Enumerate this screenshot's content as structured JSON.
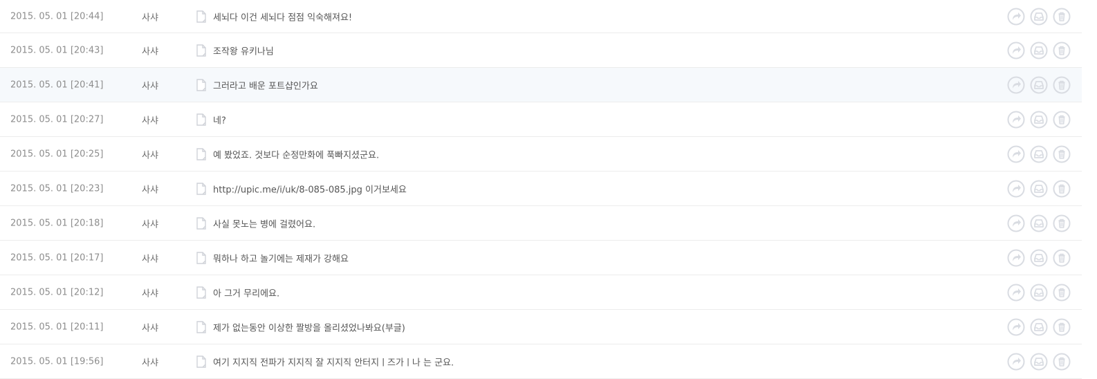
{
  "colors": {
    "icon": "#d9dce2",
    "row_border": "#ececec",
    "highlight_bg": "#f6f9fc"
  },
  "icons": {
    "document": "document-icon",
    "reply": "reply-icon",
    "save": "inbox-icon",
    "delete": "trash-icon"
  },
  "messages": [
    {
      "date": "2015. 05. 01 [20:44]",
      "user": "사샤",
      "text": "세뇌다 이건 세뇌다 점점 익숙해져요!"
    },
    {
      "date": "2015. 05. 01 [20:43]",
      "user": "사샤",
      "text": "조작왕 유키나님"
    },
    {
      "date": "2015. 05. 01 [20:41]",
      "user": "사샤",
      "text": "그러라고 배운 포트샵인가요"
    },
    {
      "date": "2015. 05. 01 [20:27]",
      "user": "사샤",
      "text": "네?"
    },
    {
      "date": "2015. 05. 01 [20:25]",
      "user": "사샤",
      "text": "예 봤었죠. 것보다 순정만화에 푹빠지셨군요."
    },
    {
      "date": "2015. 05. 01 [20:23]",
      "user": "사샤",
      "text": "http://upic.me/i/uk/8-085-085.jpg 이거보세요"
    },
    {
      "date": "2015. 05. 01 [20:18]",
      "user": "사샤",
      "text": "사실 못노는 병에 걸렸어요."
    },
    {
      "date": "2015. 05. 01 [20:17]",
      "user": "사샤",
      "text": "뭐하나 하고 놀기에는 제재가 강해요"
    },
    {
      "date": "2015. 05. 01 [20:12]",
      "user": "사샤",
      "text": "아 그거 무리에요."
    },
    {
      "date": "2015. 05. 01 [20:11]",
      "user": "사샤",
      "text": "제가 없는동안 이상한 짤방을 올리셨었나봐요(부글)"
    },
    {
      "date": "2015. 05. 01 [19:56]",
      "user": "사샤",
      "text": "여기 지지직 전파가 지지직 잘 지지직 안터지ㅣ즈가ㅣ나 는 군요."
    }
  ]
}
